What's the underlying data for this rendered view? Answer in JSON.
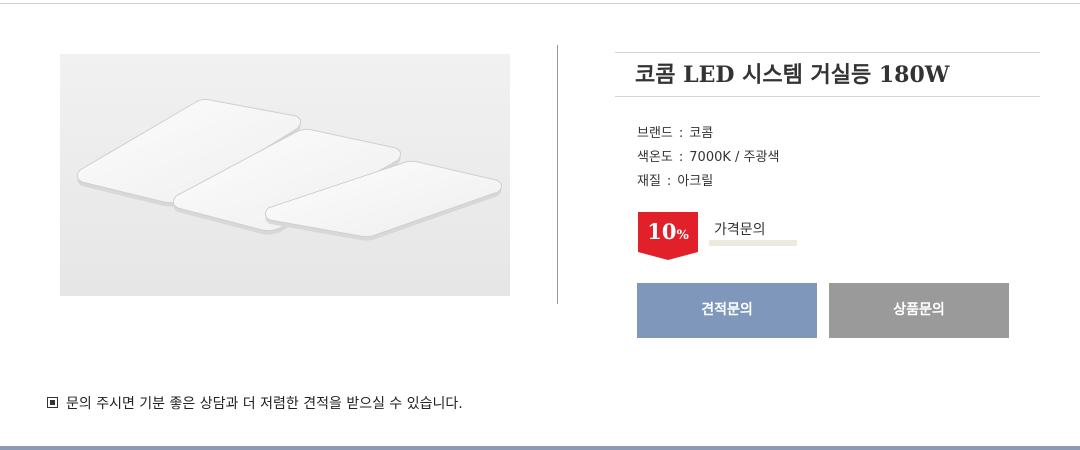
{
  "product": {
    "title": "코콤 LED 시스템 거실등 180W",
    "image_alt": "LED ceiling light with three panels",
    "specs": [
      {
        "label": "브랜드",
        "value": "코콤"
      },
      {
        "label": "색온도",
        "value": "7000K / 주광색"
      },
      {
        "label": "재질",
        "value": "아크릴"
      }
    ],
    "separator": ":"
  },
  "price": {
    "discount_number": "10",
    "discount_unit": "%",
    "label": "가격문의"
  },
  "buttons": {
    "estimate": "견적문의",
    "product": "상품문의"
  },
  "notice": {
    "text": "문의 주시면 기분 좋은 상담과 더 저렴한 견적을 받으실 수 있습니다."
  },
  "colors": {
    "badge": "#e2202a",
    "estimate_button": "#7e97bb",
    "product_button": "#9a9a9a",
    "bottom_bar": "#8c9bb3"
  }
}
